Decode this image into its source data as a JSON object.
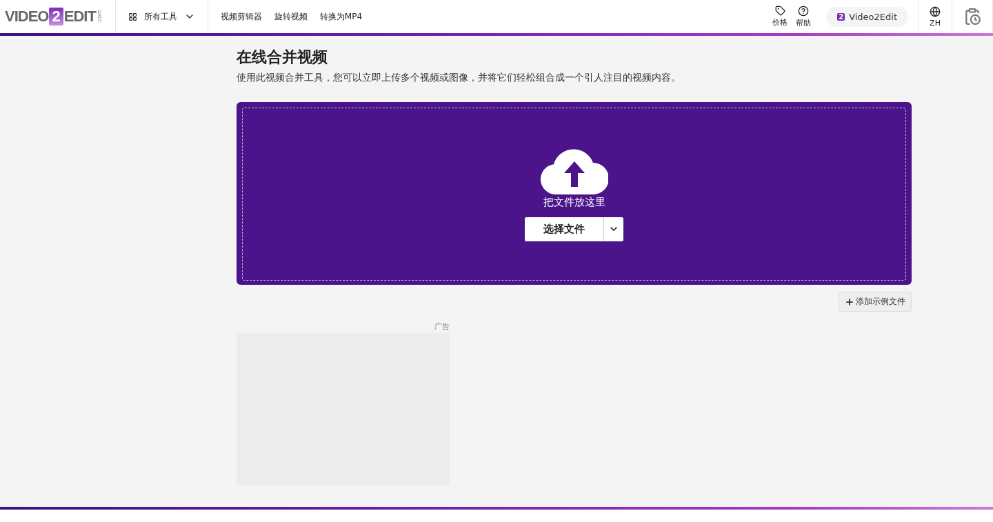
{
  "header": {
    "logo": {
      "left": "VIDEO",
      "badge": "2",
      "right": "EDIT",
      "suffix": ".com"
    },
    "all_tools": "所有工具",
    "nav_links": [
      "视频剪辑器",
      "旋转视频",
      "转换为MP4"
    ],
    "pricing": "价格",
    "help": "帮助",
    "account": {
      "badge": "2",
      "label": "Video2Edit"
    },
    "language": "ZH"
  },
  "page": {
    "title": "在线合并视频",
    "description": "使用此视频合并工具，您可以立即上传多个视频或图像，并将它们轻松组合成一个引人注目的视频内容。"
  },
  "upload": {
    "drop_text": "把文件放这里",
    "choose_button": "选择文件"
  },
  "add_sample": "添加示例文件",
  "ad": {
    "label": "广告"
  }
}
